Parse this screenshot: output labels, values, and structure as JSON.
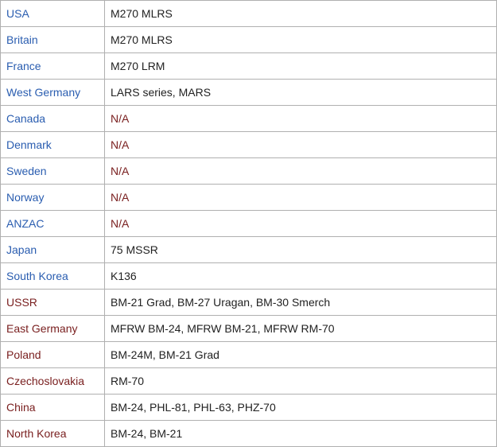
{
  "colors": {
    "western_country": "#2a5db0",
    "eastern_country": "#7a2020",
    "system_text": "#222222",
    "na_text": "#7a2020",
    "grid": "#b0b0b0"
  },
  "rows": [
    {
      "country": "USA",
      "system": "M270 MLRS",
      "bloc": "west"
    },
    {
      "country": "Britain",
      "system": "M270 MLRS",
      "bloc": "west"
    },
    {
      "country": "France",
      "system": "M270 LRM",
      "bloc": "west"
    },
    {
      "country": "West Germany",
      "system": "LARS series, MARS",
      "bloc": "west"
    },
    {
      "country": "Canada",
      "system": "N/A",
      "bloc": "west"
    },
    {
      "country": "Denmark",
      "system": "N/A",
      "bloc": "west"
    },
    {
      "country": "Sweden",
      "system": "N/A",
      "bloc": "west"
    },
    {
      "country": "Norway",
      "system": "N/A",
      "bloc": "west"
    },
    {
      "country": "ANZAC",
      "system": "N/A",
      "bloc": "west"
    },
    {
      "country": "Japan",
      "system": "75 MSSR",
      "bloc": "west"
    },
    {
      "country": "South Korea",
      "system": "K136",
      "bloc": "west"
    },
    {
      "country": "USSR",
      "system": "BM-21 Grad, BM-27 Uragan, BM-30 Smerch",
      "bloc": "east"
    },
    {
      "country": "East Germany",
      "system": "MFRW BM-24, MFRW BM-21, MFRW RM-70",
      "bloc": "east"
    },
    {
      "country": "Poland",
      "system": "BM-24M, BM-21 Grad",
      "bloc": "east"
    },
    {
      "country": "Czechoslovakia",
      "system": "RM-70",
      "bloc": "east"
    },
    {
      "country": "China",
      "system": "BM-24, PHL-81, PHL-63, PHZ-70",
      "bloc": "east"
    },
    {
      "country": "North Korea",
      "system": "BM-24, BM-21",
      "bloc": "east"
    }
  ]
}
